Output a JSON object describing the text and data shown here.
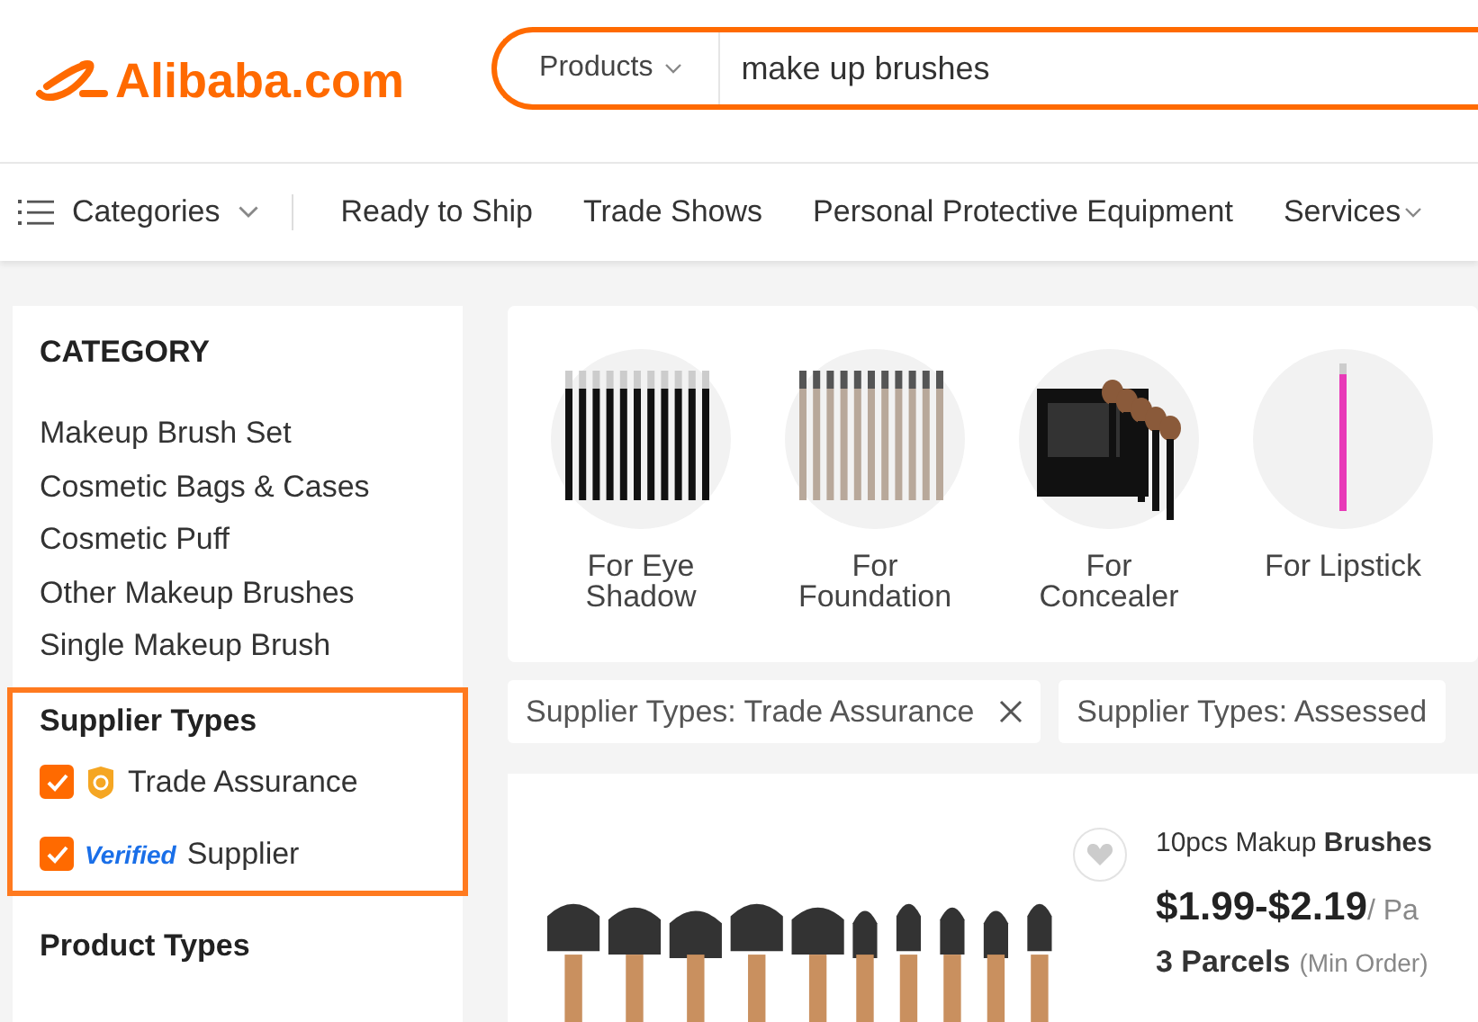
{
  "header": {
    "logo": "Alibaba.com",
    "search": {
      "scope": "Products",
      "value": "make up brushes"
    }
  },
  "nav": {
    "categories": "Categories",
    "links": [
      "Ready to Ship",
      "Trade Shows",
      "Personal Protective Equipment",
      "Services"
    ]
  },
  "sidebar": {
    "category_title": "CATEGORY",
    "categories": [
      "Makeup Brush Set",
      "Cosmetic Bags & Cases",
      "Cosmetic Puff",
      "Other Makeup Brushes",
      "Single Makeup Brush"
    ],
    "supplier_title": "Supplier Types",
    "supplier_types": [
      {
        "kind": "assurance",
        "label": "Trade Assurance",
        "checked": true
      },
      {
        "kind": "verified",
        "badge": "Verified",
        "label": "Supplier",
        "checked": true
      }
    ],
    "product_title": "Product Types"
  },
  "subcategories": [
    {
      "label": "For Eye Shadow",
      "kind": "dark"
    },
    {
      "label": "For Foundation",
      "kind": "champagne"
    },
    {
      "label": "For Concealer",
      "kind": "boxed"
    },
    {
      "label": "For Lipstick",
      "kind": "single"
    }
  ],
  "filters": [
    {
      "label": "Supplier Types: Trade Assurance",
      "removable": true
    },
    {
      "label": "Supplier Types: Assessed",
      "removable": false
    }
  ],
  "product": {
    "title": "10pcs Makup **Brushes**",
    "price": "$1.99-$2.19",
    "unit": "/ Pa",
    "min_qty": "3 Parcels",
    "min_label": "(Min Order)"
  }
}
